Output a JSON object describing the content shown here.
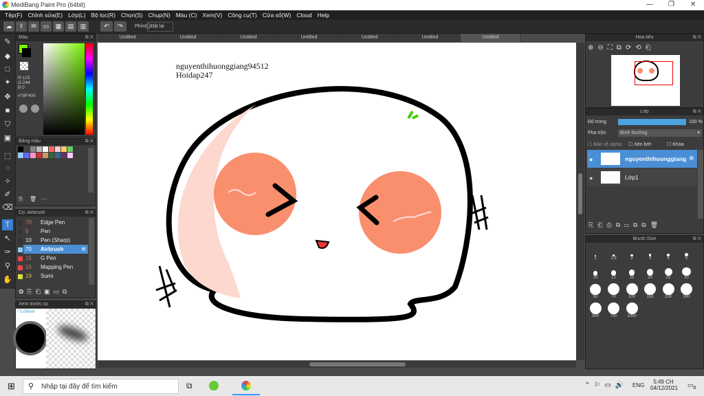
{
  "window": {
    "title": "MediBang Paint Pro (64bit)"
  },
  "menu": [
    "Tệp(F)",
    "Chỉnh sửa(E)",
    "Lớp(L)",
    "Bộ lọc(R)",
    "Chọn(S)",
    "Chụp(N)",
    "Màu (C)",
    "Xem(V)",
    "Công cụ(T)",
    "Cửa sổ(W)",
    "Cloud",
    "Help"
  ],
  "toolbar": {
    "phim_label": "Phím",
    "reset_label": "Đặt lại"
  },
  "color_panel": {
    "title": "Màu",
    "r": "R:123",
    "g": "G:244",
    "b": "B:0",
    "hex": "#78F400",
    "accent": "#78F400"
  },
  "palette_panel": {
    "title": "Bảng màu",
    "footer": "----"
  },
  "brush_panel": {
    "title": "Cọ: Airbrush",
    "items": [
      {
        "size": "70",
        "name": "Edge Pen"
      },
      {
        "size": "5",
        "name": "Pen"
      },
      {
        "size": "10",
        "name": "Pen (Sharp)"
      },
      {
        "size": "70",
        "name": "Airbrush"
      },
      {
        "size": "15",
        "name": "G Pen"
      },
      {
        "size": "15",
        "name": "Mapping Pen"
      },
      {
        "size": "19",
        "name": "Sumi"
      }
    ]
  },
  "preview_panel": {
    "title": "Xem trước cọ",
    "size": "* 5.08mm"
  },
  "tabs": [
    "Untitled",
    "Untitled",
    "Untitled",
    "Untitled",
    "Untitled",
    "Untitled",
    "Untitled"
  ],
  "canvas": {
    "text_line1": "nguyenthihuonggiang94512",
    "text_line2": "Hoidap247"
  },
  "navigator": {
    "title": "Hoa tiêu"
  },
  "layer_panel": {
    "title": "Lớp",
    "opacity_label": "Độ trong",
    "opacity_value": "100 %",
    "blend_label": "Pha trộn",
    "blend_value": "Bình thường",
    "protect_alpha": "Bảo vệ alpha",
    "clipping": "Xén bớt",
    "lock": "Khóa",
    "layers": [
      {
        "name": "nguyenthihuonggiang"
      },
      {
        "name": "Lớp1"
      }
    ]
  },
  "brush_size_panel": {
    "title": "Brush Size",
    "sizes": [
      "1",
      "1.5",
      "2",
      "3",
      "4",
      "5",
      "10",
      "12",
      "15",
      "20",
      "25",
      "30",
      "50",
      "70",
      "100",
      "150",
      "200",
      "300",
      "500",
      "700",
      "1000"
    ]
  },
  "taskbar": {
    "search_placeholder": "Nhập tại đây để tìm kiếm",
    "time": "5:49 CH",
    "date": "04/12/2021",
    "lang": "ENG",
    "notif": "6"
  }
}
